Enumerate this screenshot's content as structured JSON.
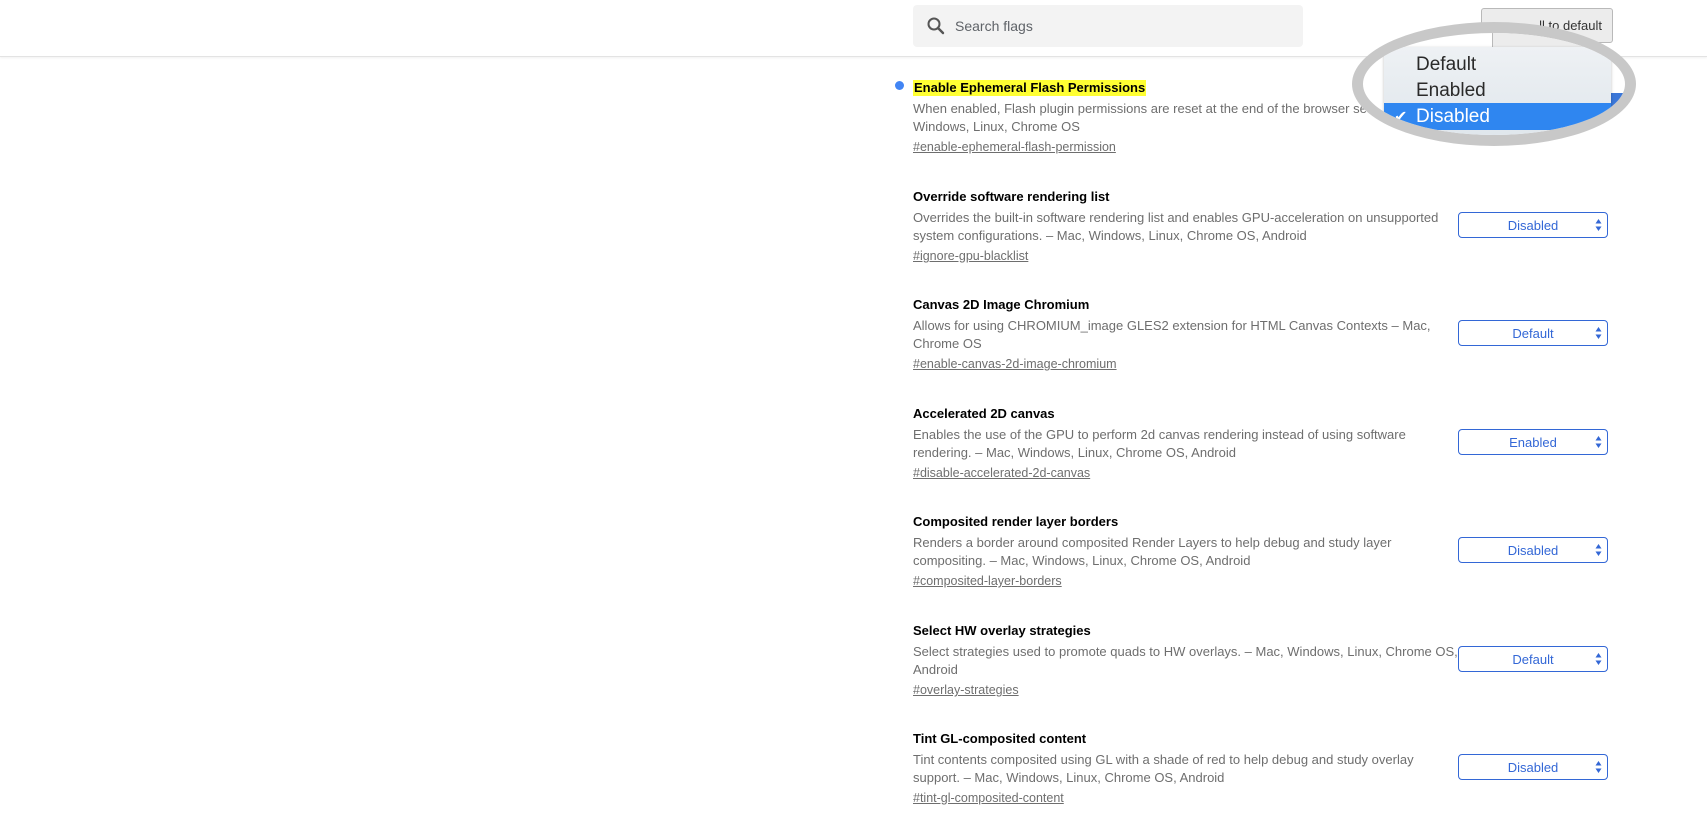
{
  "header": {
    "search": {
      "placeholder": "Search flags",
      "value": "",
      "icon": "search-icon"
    },
    "reset_button_label": "Reset all to default",
    "reset_button_visible_text": "ll to default"
  },
  "flags": [
    {
      "title": "Enable Ephemeral Flash Permissions",
      "highlighted": true,
      "modified_indicator": true,
      "description_line1": "When enabled, Flash plugin permissions are reset at the end of the browser se",
      "description_line2": "Windows, Linux, Chrome OS",
      "link": "#enable-ephemeral-flash-permission",
      "value": "Disabled"
    },
    {
      "title": "Override software rendering list",
      "description_line1": "Overrides the built-in software rendering list and enables GPU-acceleration on unsupported",
      "description_line2": "system configurations. – Mac, Windows, Linux, Chrome OS, Android",
      "link": "#ignore-gpu-blacklist",
      "value": "Disabled"
    },
    {
      "title": "Canvas 2D Image Chromium",
      "description_line1": "Allows for using CHROMIUM_image GLES2 extension for HTML Canvas Contexts – Mac,",
      "description_line2": "Chrome OS",
      "link": "#enable-canvas-2d-image-chromium",
      "value": "Default"
    },
    {
      "title": "Accelerated 2D canvas",
      "description_line1": "Enables the use of the GPU to perform 2d canvas rendering instead of using software",
      "description_line2": "rendering. – Mac, Windows, Linux, Chrome OS, Android",
      "link": "#disable-accelerated-2d-canvas",
      "value": "Enabled"
    },
    {
      "title": "Composited render layer borders",
      "description_line1": "Renders a border around composited Render Layers to help debug and study layer",
      "description_line2": "compositing. – Mac, Windows, Linux, Chrome OS, Android",
      "link": "#composited-layer-borders",
      "value": "Disabled"
    },
    {
      "title": "Select HW overlay strategies",
      "description_line1": "Select strategies used to promote quads to HW overlays. – Mac, Windows, Linux, Chrome OS,",
      "description_line2": "Android",
      "link": "#overlay-strategies",
      "value": "Default"
    },
    {
      "title": "Tint GL-composited content",
      "description_line1": "Tint contents composited using GL with a shade of red to help debug and study overlay",
      "description_line2": "support. – Mac, Windows, Linux, Chrome OS, Android",
      "link": "#tint-gl-composited-content",
      "value": "Disabled"
    }
  ],
  "dropdown": {
    "options": [
      "Default",
      "Enabled",
      "Disabled"
    ],
    "selected": "Disabled",
    "check_glyph": "✔"
  },
  "colors": {
    "accent": "#3367d6",
    "highlight": "#ffff33",
    "modified_dot": "#4285f4",
    "dropdown_selected": "#2f86f0",
    "magnifier_ring": "#c8c8c8"
  }
}
